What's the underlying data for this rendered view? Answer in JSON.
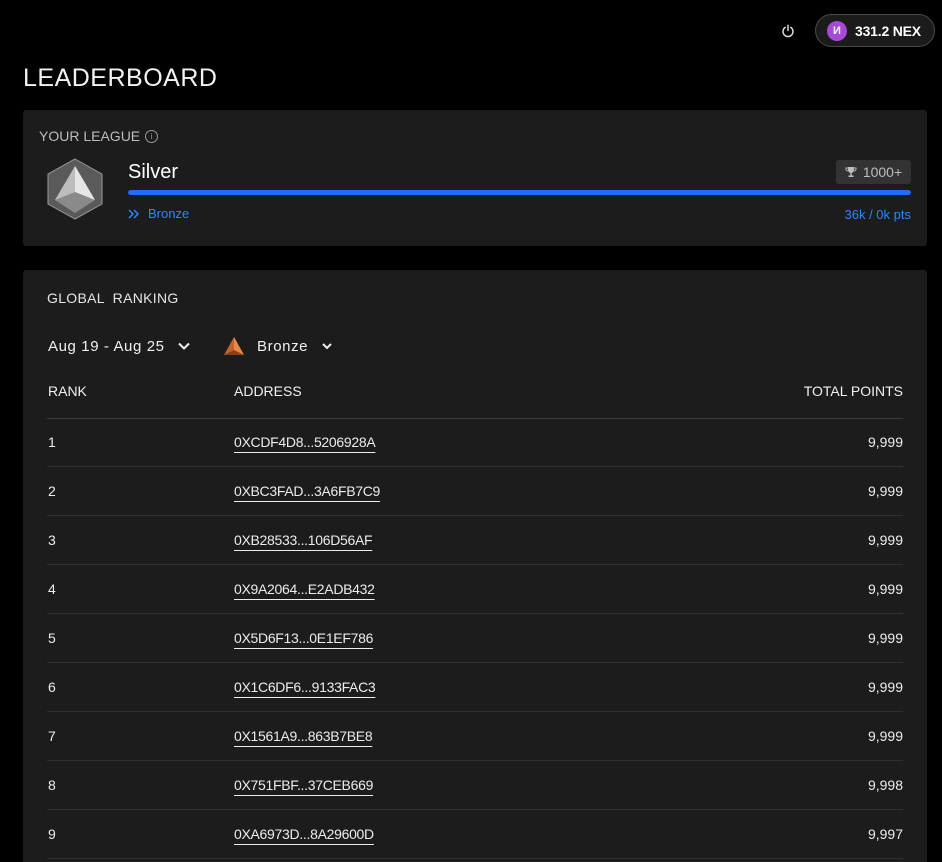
{
  "header": {
    "wallet_amount": "331.2 NEX",
    "token_glyph": "И",
    "token_color": "#a64ad8"
  },
  "page_title": "LEADERBOARD",
  "league": {
    "label": "YOUR LEAGUE",
    "name": "Silver",
    "trophy_threshold": "1000+",
    "progress_fraction": 1.0,
    "next_league": "Bronze",
    "points_progress": "36k / 0k pts",
    "accent_color": "#1f6ff2"
  },
  "ranking": {
    "title": "GLOBAL  RANKING",
    "date_filter": "Aug 19 - Aug 25",
    "league_filter": "Bronze",
    "columns": {
      "rank": "RANK",
      "address": "ADDRESS",
      "points": "TOTAL POINTS"
    },
    "rows": [
      {
        "rank": "1",
        "address": "0XCDF4D8...5206928A",
        "points": "9,999"
      },
      {
        "rank": "2",
        "address": "0XBC3FAD...3A6FB7C9",
        "points": "9,999"
      },
      {
        "rank": "3",
        "address": "0XB28533...106D56AF",
        "points": "9,999"
      },
      {
        "rank": "4",
        "address": "0X9A2064...E2ADB432",
        "points": "9,999"
      },
      {
        "rank": "5",
        "address": "0X5D6F13...0E1EF786",
        "points": "9,999"
      },
      {
        "rank": "6",
        "address": "0X1C6DF6...9133FAC3",
        "points": "9,999"
      },
      {
        "rank": "7",
        "address": "0X1561A9...863B7BE8",
        "points": "9,999"
      },
      {
        "rank": "8",
        "address": "0X751FBF...37CEB669",
        "points": "9,998"
      },
      {
        "rank": "9",
        "address": "0XA6973D...8A29600D",
        "points": "9,997"
      }
    ]
  }
}
